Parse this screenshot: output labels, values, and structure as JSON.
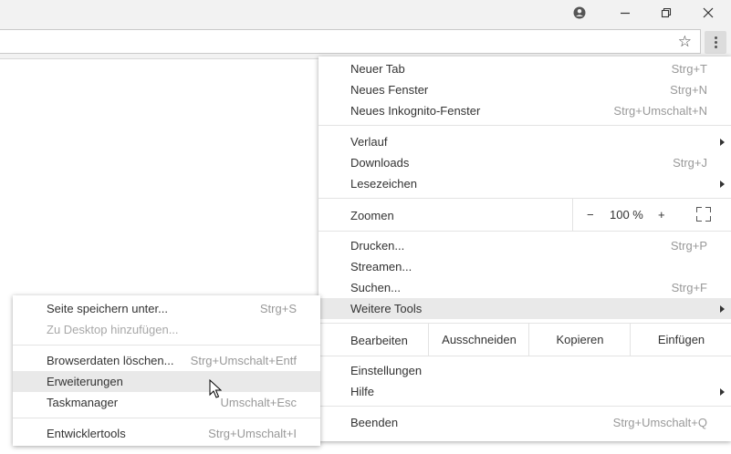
{
  "titlebar": {
    "profile_icon": "account-circle-icon",
    "minimize_icon": "minimize-icon",
    "restore_icon": "restore-icon",
    "close_icon": "close-icon"
  },
  "toolbar": {
    "bookmark_icon": "star-icon",
    "menu_icon": "kebab-menu-icon"
  },
  "main_menu": {
    "new_tab": {
      "label": "Neuer Tab",
      "shortcut": "Strg+T"
    },
    "new_window": {
      "label": "Neues Fenster",
      "shortcut": "Strg+N"
    },
    "new_incognito": {
      "label": "Neues Inkognito-Fenster",
      "shortcut": "Strg+Umschalt+N"
    },
    "history": {
      "label": "Verlauf"
    },
    "downloads": {
      "label": "Downloads",
      "shortcut": "Strg+J"
    },
    "bookmarks": {
      "label": "Lesezeichen"
    },
    "zoom": {
      "label": "Zoomen",
      "minus": "−",
      "value": "100 %",
      "plus": "+"
    },
    "print": {
      "label": "Drucken...",
      "shortcut": "Strg+P"
    },
    "cast": {
      "label": "Streamen..."
    },
    "find": {
      "label": "Suchen...",
      "shortcut": "Strg+F"
    },
    "more_tools": {
      "label": "Weitere Tools"
    },
    "edit": {
      "label": "Bearbeiten",
      "cut": "Ausschneiden",
      "copy": "Kopieren",
      "paste": "Einfügen"
    },
    "settings": {
      "label": "Einstellungen"
    },
    "help": {
      "label": "Hilfe"
    },
    "exit": {
      "label": "Beenden",
      "shortcut": "Strg+Umschalt+Q"
    }
  },
  "sub_menu": {
    "save_page": {
      "label": "Seite speichern unter...",
      "shortcut": "Strg+S"
    },
    "add_to_desktop": {
      "label": "Zu Desktop hinzufügen..."
    },
    "clear_data": {
      "label": "Browserdaten löschen...",
      "shortcut": "Strg+Umschalt+Entf"
    },
    "extensions": {
      "label": "Erweiterungen"
    },
    "task_manager": {
      "label": "Taskmanager",
      "shortcut": "Umschalt+Esc"
    },
    "dev_tools": {
      "label": "Entwicklertools",
      "shortcut": "Strg+Umschalt+I"
    }
  }
}
